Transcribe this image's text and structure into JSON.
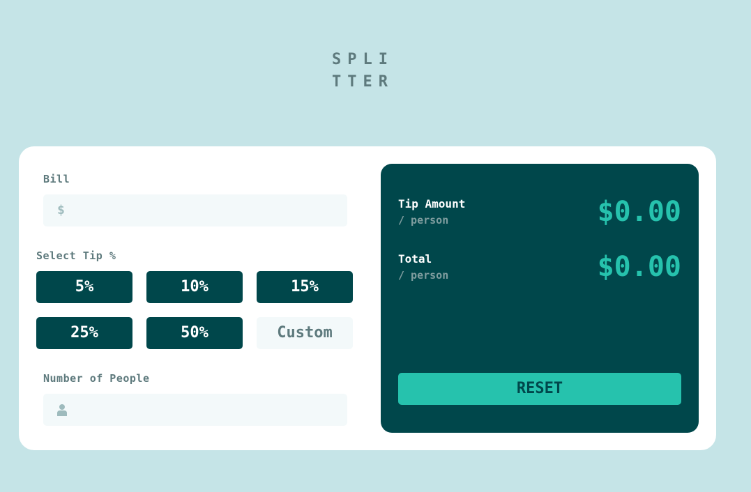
{
  "app": {
    "logo_line1": "SPLI",
    "logo_line2": "TTER"
  },
  "form": {
    "bill_label": "Bill",
    "bill_prefix": "$",
    "bill_value": "",
    "tip_label": "Select Tip %",
    "tips": [
      "5%",
      "10%",
      "15%",
      "25%",
      "50%"
    ],
    "custom_placeholder": "Custom",
    "people_label": "Number of People",
    "people_icon": "person-icon",
    "people_value": ""
  },
  "results": {
    "tip_label": "Tip Amount",
    "tip_sub": "/ person",
    "tip_value": "$0.00",
    "total_label": "Total",
    "total_sub": "/ person",
    "total_value": "$0.00",
    "reset_label": "RESET"
  },
  "colors": {
    "background": "#c5e4e7",
    "dark_cyan": "#00474b",
    "accent": "#26c2ad",
    "label_grey": "#5e7a7d",
    "input_bg": "#f3f9fa"
  }
}
